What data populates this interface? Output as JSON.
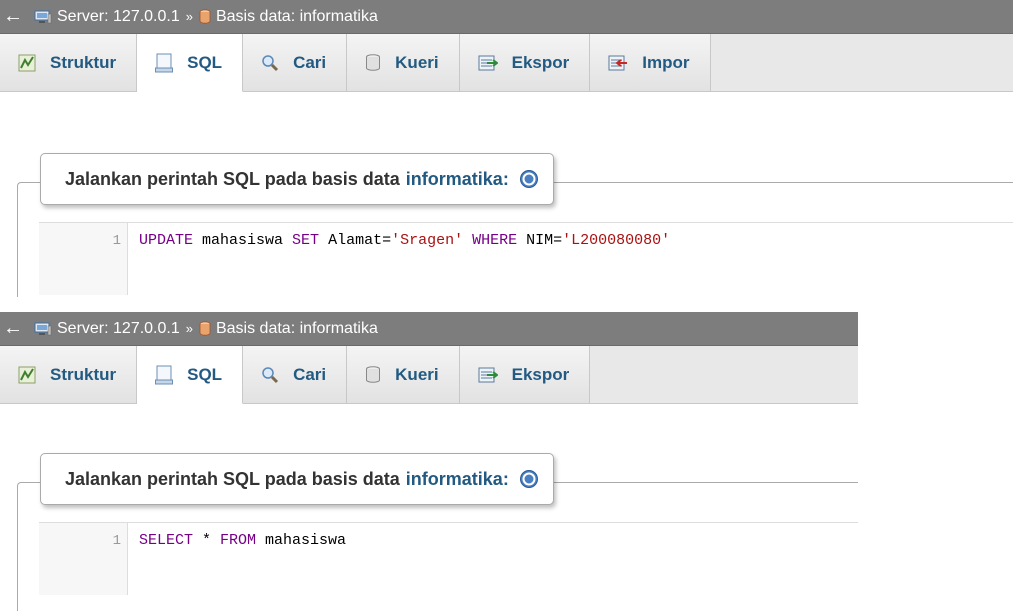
{
  "colors": {
    "breadcrumb_bg": "#7d7d7d",
    "tab_text": "#235a81",
    "keyword": "#770088",
    "string": "#aa1111"
  },
  "panels": [
    {
      "breadcrumb": {
        "back_icon": "left-arrow-icon",
        "server_label": "Server: 127.0.0.1",
        "separator": "»",
        "database_label": "Basis data: informatika"
      },
      "tabs": [
        {
          "label": "Struktur",
          "icon": "structure-icon"
        },
        {
          "label": "SQL",
          "icon": "sql-icon",
          "active": true
        },
        {
          "label": "Cari",
          "icon": "search-icon"
        },
        {
          "label": "Kueri",
          "icon": "query-icon"
        },
        {
          "label": "Ekspor",
          "icon": "export-icon"
        },
        {
          "label": "Impor",
          "icon": "import-icon"
        }
      ],
      "legend": {
        "prefix": "Jalankan perintah SQL pada basis data",
        "database": "informatika:",
        "help_icon": "help-icon"
      },
      "editor": {
        "line_number": "1",
        "tokens": {
          "t1": "UPDATE",
          "t2": " mahasiswa ",
          "t3": "SET",
          "t4": " Alamat=",
          "t5": "'Sragen'",
          "t6": " ",
          "t7": "WHERE",
          "t8": " NIM=",
          "t9": "'L200080080'"
        }
      }
    },
    {
      "breadcrumb": {
        "back_icon": "left-arrow-icon",
        "server_label": "Server: 127.0.0.1",
        "separator": "»",
        "database_label": "Basis data: informatika"
      },
      "tabs": [
        {
          "label": "Struktur",
          "icon": "structure-icon"
        },
        {
          "label": "SQL",
          "icon": "sql-icon",
          "active": true
        },
        {
          "label": "Cari",
          "icon": "search-icon"
        },
        {
          "label": "Kueri",
          "icon": "query-icon"
        },
        {
          "label": "Ekspor",
          "icon": "export-icon"
        }
      ],
      "legend": {
        "prefix": "Jalankan perintah SQL pada basis data",
        "database": "informatika:",
        "help_icon": "help-icon"
      },
      "editor": {
        "line_number": "1",
        "tokens": {
          "t1": "SELECT",
          "t2": " * ",
          "t3": "FROM",
          "t4": " mahasiswa"
        }
      }
    }
  ]
}
